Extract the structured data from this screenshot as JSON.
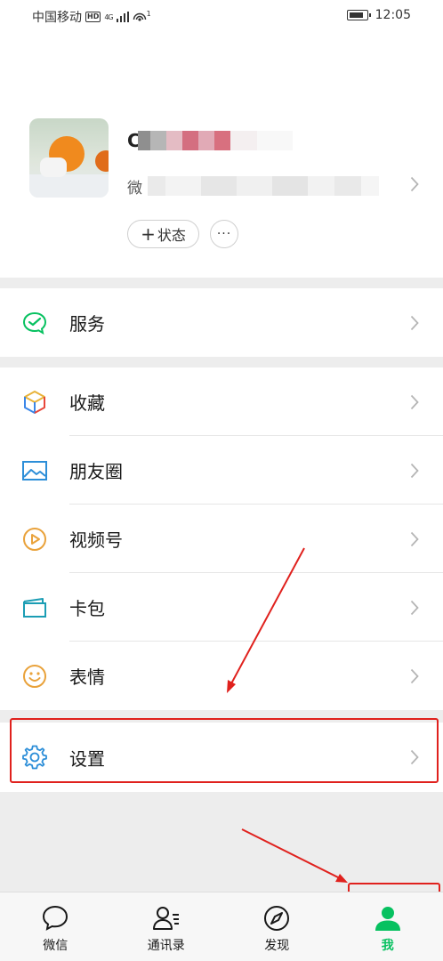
{
  "status_bar": {
    "carrier": "中国移动",
    "hd": "HD",
    "network": "4G",
    "hotspot_count": "1",
    "time": "12:05"
  },
  "profile": {
    "nickname_initial": "C",
    "wechat_id_prefix": "微",
    "status_button": "状态",
    "status_plus": "+",
    "more_button": "···"
  },
  "menu": {
    "services": "服务",
    "favorites": "收藏",
    "moments": "朋友圈",
    "channels": "视频号",
    "cards": "卡包",
    "stickers": "表情",
    "settings": "设置"
  },
  "tabbar": {
    "chats": "微信",
    "contacts": "通讯录",
    "discover": "发现",
    "me": "我",
    "active_tab": "me"
  },
  "colors": {
    "accent_green": "#07c160",
    "annotation_red": "#e0211d",
    "background": "#ededed"
  }
}
